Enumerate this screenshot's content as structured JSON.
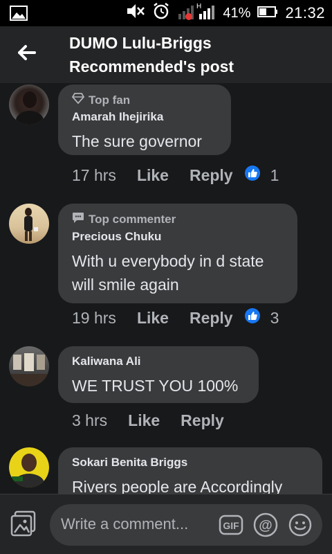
{
  "status_bar": {
    "battery_percent": "41%",
    "time": "21:32",
    "icons": [
      "image-icon",
      "mute-icon",
      "alarm-icon",
      "signal-icon",
      "battery-icon"
    ]
  },
  "header": {
    "title_line1": "DUMO Lulu-Briggs",
    "title_line2": "Recommended's post"
  },
  "comments": [
    {
      "badge": "Top fan",
      "badge_icon": "diamond-icon",
      "author": "Amarah Ihejirika",
      "text": "The sure governor",
      "time": "17 hrs",
      "like": "Like",
      "reply": "Reply",
      "reactions": "1"
    },
    {
      "badge": "Top commenter",
      "badge_icon": "comment-bubble-icon",
      "author": "Precious Chuku",
      "text_line1": "With u everybody in d state",
      "text_line2": "will smile again",
      "time": "19 hrs",
      "like": "Like",
      "reply": "Reply",
      "reactions": "3"
    },
    {
      "author": "Kaliwana Ali",
      "text": "WE TRUST YOU 100%",
      "time": "3 hrs",
      "like": "Like",
      "reply": "Reply"
    },
    {
      "author": "Sokari Benita Briggs",
      "text": "Rivers people are Accordingly"
    }
  ],
  "composer": {
    "placeholder": "Write a comment...",
    "gif_label": "GIF",
    "at_label": "@"
  },
  "colors": {
    "background": "#18191a",
    "surface": "#242526",
    "bubble": "#3a3b3c",
    "like_blue": "#1877f2"
  }
}
